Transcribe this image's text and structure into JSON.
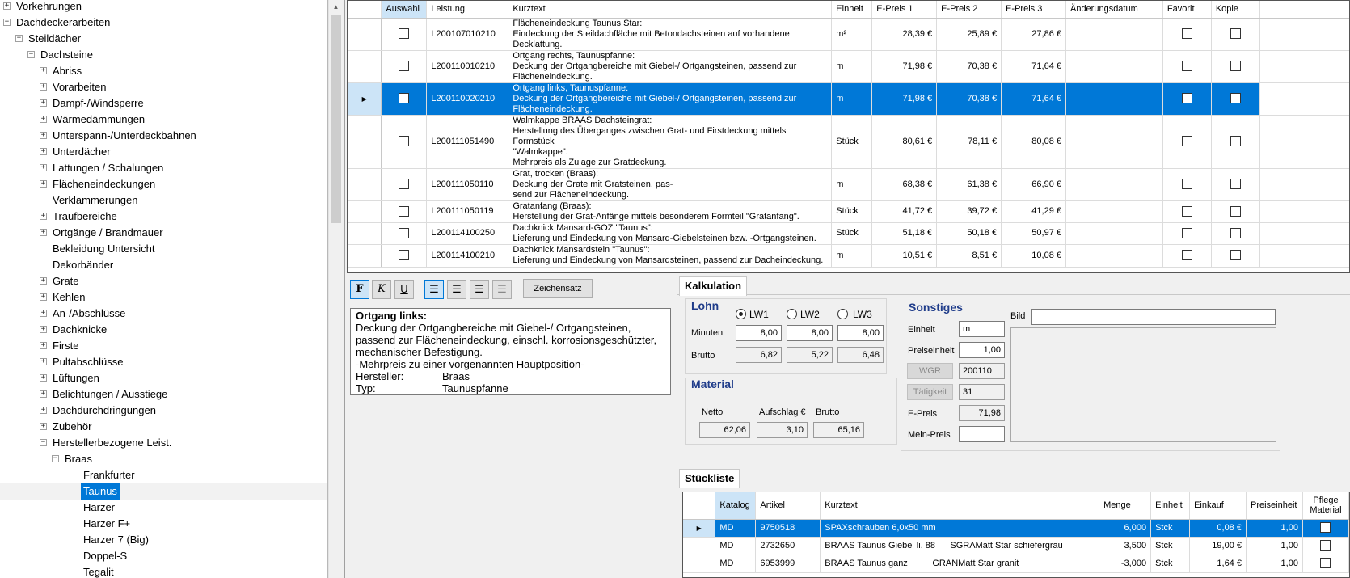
{
  "tree": {
    "items": [
      {
        "label": "Vorkehrungen",
        "level": 0,
        "expander": "+"
      },
      {
        "label": "Dachdeckerarbeiten",
        "level": 0,
        "expander": "−"
      },
      {
        "label": "Steildächer",
        "level": 1,
        "expander": "−"
      },
      {
        "label": "Dachsteine",
        "level": 2,
        "expander": "−"
      },
      {
        "label": "Abriss",
        "level": 3,
        "expander": "+"
      },
      {
        "label": "Vorarbeiten",
        "level": 3,
        "expander": "+"
      },
      {
        "label": "Dampf-/Windsperre",
        "level": 3,
        "expander": "+"
      },
      {
        "label": "Wärmedämmungen",
        "level": 3,
        "expander": "+"
      },
      {
        "label": "Unterspann-/Unterdeckbahnen",
        "level": 3,
        "expander": "+"
      },
      {
        "label": "Unterdächer",
        "level": 3,
        "expander": "+"
      },
      {
        "label": "Lattungen / Schalungen",
        "level": 3,
        "expander": "+"
      },
      {
        "label": "Flächeneindeckungen",
        "level": 3,
        "expander": "+"
      },
      {
        "label": "Verklammerungen",
        "level": 3,
        "expander": ""
      },
      {
        "label": "Traufbereiche",
        "level": 3,
        "expander": "+"
      },
      {
        "label": "Ortgänge / Brandmauer",
        "level": 3,
        "expander": "+"
      },
      {
        "label": "Bekleidung Untersicht",
        "level": 3,
        "expander": ""
      },
      {
        "label": "Dekorbänder",
        "level": 3,
        "expander": ""
      },
      {
        "label": "Grate",
        "level": 3,
        "expander": "+"
      },
      {
        "label": "Kehlen",
        "level": 3,
        "expander": "+"
      },
      {
        "label": "An-/Abschlüsse",
        "level": 3,
        "expander": "+"
      },
      {
        "label": "Dachknicke",
        "level": 3,
        "expander": "+"
      },
      {
        "label": "Firste",
        "level": 3,
        "expander": "+"
      },
      {
        "label": "Pultabschlüsse",
        "level": 3,
        "expander": "+"
      },
      {
        "label": "Lüftungen",
        "level": 3,
        "expander": "+"
      },
      {
        "label": "Belichtungen / Ausstiege",
        "level": 3,
        "expander": "+"
      },
      {
        "label": "Dachdurchdringungen",
        "level": 3,
        "expander": "+"
      },
      {
        "label": "Zubehör",
        "level": 3,
        "expander": "+"
      },
      {
        "label": "Herstellerbezogene Leist.",
        "level": 3,
        "expander": "−"
      },
      {
        "label": "Braas",
        "level": 4,
        "expander": "−"
      },
      {
        "label": "Frankfurter",
        "level": 5,
        "expander": ""
      },
      {
        "label": "Taunus",
        "level": 5,
        "expander": "",
        "selected": true
      },
      {
        "label": "Harzer",
        "level": 5,
        "expander": ""
      },
      {
        "label": "Harzer F+",
        "level": 5,
        "expander": ""
      },
      {
        "label": "Harzer 7 (Big)",
        "level": 5,
        "expander": ""
      },
      {
        "label": "Doppel-S",
        "level": 5,
        "expander": ""
      },
      {
        "label": "Tegalit",
        "level": 5,
        "expander": ""
      }
    ]
  },
  "grid": {
    "columns": [
      "Auswahl",
      "Leistung",
      "Kurztext",
      "Einheit",
      "E-Preis 1",
      "E-Preis 2",
      "E-Preis 3",
      "Änderungsdatum",
      "Favorit",
      "Kopie"
    ],
    "rows": [
      {
        "leistung": "L200107010210",
        "kurztext": "Flächeneindeckung Taunus Star:\nEindeckung der Steildachfläche mit Betondachsteinen auf vorhandene\nDecklattung.",
        "einheit": "m²",
        "p1": "28,39 €",
        "p2": "25,89 €",
        "p3": "27,86 €",
        "datum": ""
      },
      {
        "leistung": "L200110010210",
        "kurztext": "Ortgang rechts, Taunuspfanne:\nDeckung der Ortgangbereiche mit Giebel-/ Ortgangsteinen, passend zur\nFlächeneindeckung.",
        "einheit": "m",
        "p1": "71,98 €",
        "p2": "70,38 €",
        "p3": "71,64 €",
        "datum": ""
      },
      {
        "leistung": "L200110020210",
        "kurztext": "Ortgang links, Taunuspfanne:\nDeckung der Ortgangbereiche mit Giebel-/ Ortgangsteinen, passend zur\nFlächeneindeckung.",
        "einheit": "m",
        "p1": "71,98 €",
        "p2": "70,38 €",
        "p3": "71,64 €",
        "datum": "",
        "selected": true
      },
      {
        "leistung": "L200111051490",
        "kurztext": "Walmkappe BRAAS Dachsteingrat:\nHerstellung des Überganges zwischen Grat- und Firstdeckung mittels Formstück\n\"Walmkappe\".\nMehrpreis als Zulage zur Gratdeckung.",
        "einheit": "Stück",
        "p1": "80,61 €",
        "p2": "78,11 €",
        "p3": "80,08 €",
        "datum": ""
      },
      {
        "leistung": "L200111050110",
        "kurztext": "Grat, trocken (Braas):\nDeckung der Grate mit Gratsteinen, pas-\nsend zur Flächeneindeckung.",
        "einheit": "m",
        "p1": "68,38 €",
        "p2": "61,38 €",
        "p3": "66,90 €",
        "datum": ""
      },
      {
        "leistung": "L200111050119",
        "kurztext": "Gratanfang (Braas):\nHerstellung der Grat-Anfänge mittels besonderem Formteil \"Gratanfang\".",
        "einheit": "Stück",
        "p1": "41,72 €",
        "p2": "39,72 €",
        "p3": "41,29 €",
        "datum": ""
      },
      {
        "leistung": "L200114100250",
        "kurztext": "Dachknick Mansard-GOZ \"Taunus\":\nLieferung und Eindeckung von Mansard-Giebelsteinen bzw. -Ortgangsteinen.",
        "einheit": "Stück",
        "p1": "51,18 €",
        "p2": "50,18 €",
        "p3": "50,97 €",
        "datum": ""
      },
      {
        "leistung": "L200114100210",
        "kurztext": "Dachknick Mansardstein \"Taunus\":\nLieferung und Eindeckung von Mansardsteinen, passend zur Dacheindeckung.",
        "einheit": "m",
        "p1": "10,51 €",
        "p2": "8,51 €",
        "p3": "10,08 €",
        "datum": ""
      }
    ]
  },
  "format_toolbar": {
    "bold": "F",
    "italic": "K",
    "underline": "U",
    "zeichensatz": "Zeichensatz"
  },
  "longtext": {
    "heading": "Ortgang links:",
    "lines": [
      "Deckung der Ortgangbereiche mit Giebel-/ Ortgangsteinen,",
      "passend zur Flächeneindeckung, einschl. korrosionsgeschützter,",
      "mechanischer Befestigung.",
      "-Mehrpreis zu einer vorgenannten Hauptposition-"
    ],
    "hersteller_label": "Hersteller:",
    "hersteller_value": "Braas",
    "typ_label": "Typ:",
    "typ_value": "Taunuspfanne"
  },
  "kalkulation": {
    "tab": "Kalkulation",
    "lohn": {
      "title": "Lohn",
      "lw1": "LW1",
      "lw2": "LW2",
      "lw3": "LW3",
      "minuten_label": "Minuten",
      "brutto_label": "Brutto",
      "minuten": [
        "8,00",
        "8,00",
        "8,00"
      ],
      "brutto": [
        "6,82",
        "5,22",
        "6,48"
      ]
    },
    "material": {
      "title": "Material",
      "netto_label": "Netto",
      "aufschlag_label": "Aufschlag €",
      "brutto_label": "Brutto",
      "netto": "62,06",
      "aufschlag": "3,10",
      "brutto": "65,16"
    },
    "sonstiges": {
      "title": "Sonstiges",
      "bild_label": "Bild",
      "bild_value": "",
      "einheit_label": "Einheit",
      "einheit": "m",
      "preiseinheit_label": "Preiseinheit",
      "preiseinheit": "1,00",
      "wgr_label": "WGR",
      "wgr": "200110",
      "taetigkeit_label": "Tätigkeit",
      "taetigkeit": "31",
      "epreis_label": "E-Preis",
      "epreis": "71,98",
      "meinpreis_label": "Mein-Preis",
      "meinpreis": ""
    }
  },
  "stueckliste": {
    "tab": "Stückliste",
    "columns": [
      "Katalog",
      "Artikel",
      "Kurztext",
      "Menge",
      "Einheit",
      "Einkauf",
      "Preiseinheit",
      "Pflege Material"
    ],
    "rows": [
      {
        "katalog": "MD",
        "artikel": "9750518",
        "kurztext": "SPAXschrauben 6,0x50 mm",
        "menge": "6,000",
        "einheit": "Stck",
        "einkauf": "0,08 €",
        "preiseinheit": "1,00",
        "selected": true
      },
      {
        "katalog": "MD",
        "artikel": "2732650",
        "kurztext": "BRAAS Taunus Giebel li. 88      SGRAMatt Star schiefergrau",
        "menge": "3,500",
        "einheit": "Stck",
        "einkauf": "19,00 €",
        "preiseinheit": "1,00"
      },
      {
        "katalog": "MD",
        "artikel": "6953999",
        "kurztext": "BRAAS Taunus ganz          GRANMatt Star granit",
        "menge": "-3,000",
        "einheit": "Stck",
        "einkauf": "1,64 €",
        "preiseinheit": "1,00"
      }
    ]
  }
}
